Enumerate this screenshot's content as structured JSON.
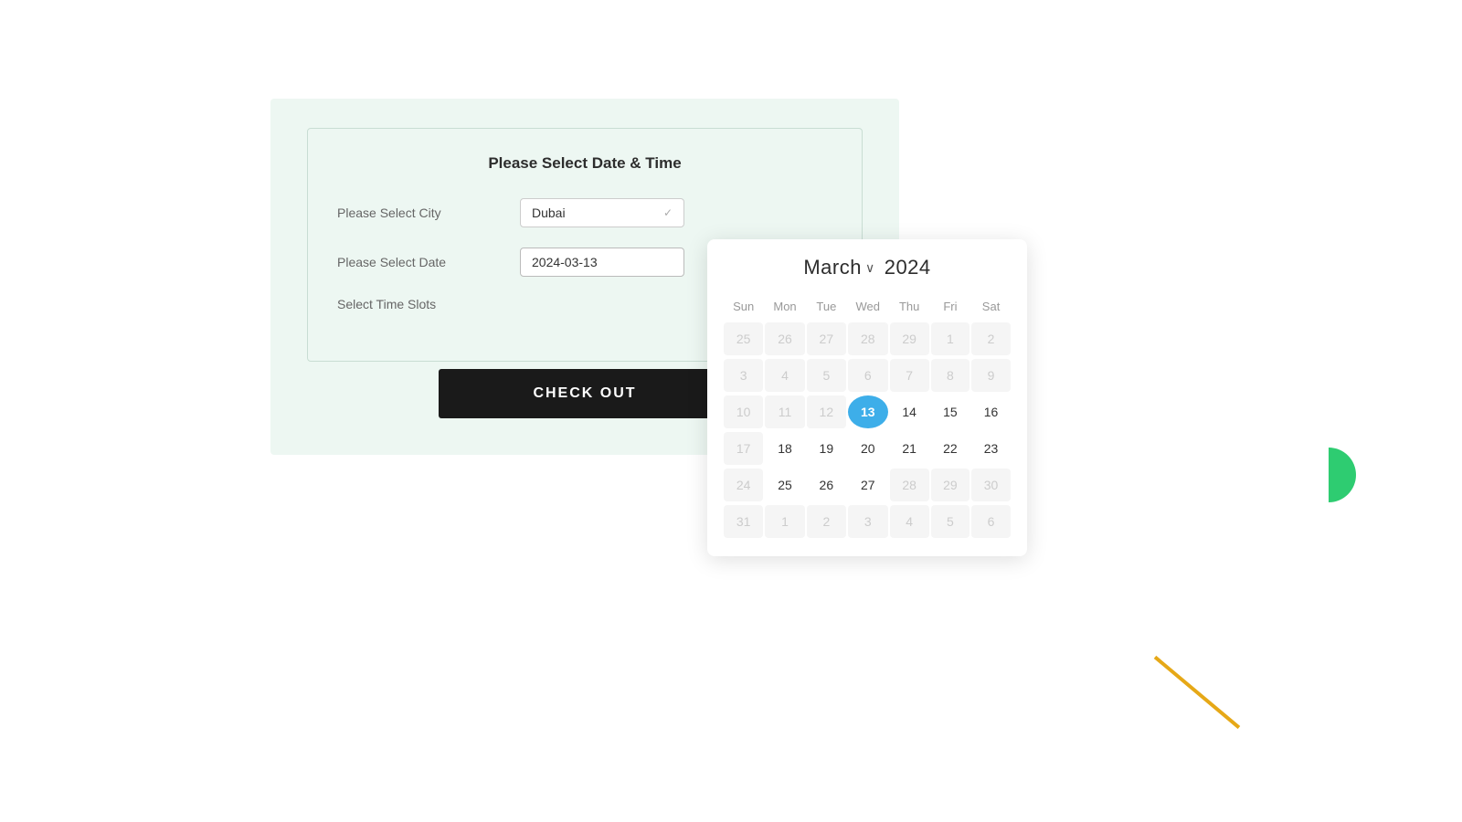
{
  "page": {
    "background": "#ffffff"
  },
  "card": {
    "title": "Please Select Date & Time",
    "city_label": "Please Select City",
    "date_label": "Please Select Date",
    "time_label": "Select Time Slots",
    "city_value": "Dubai",
    "date_value": "2024-03-13",
    "checkout_label": "CHECK OUT"
  },
  "calendar": {
    "month_label": "March",
    "month_arrow": "∨",
    "year_label": "2024",
    "headers": [
      "Sun",
      "Mon",
      "Tue",
      "Wed",
      "Thu",
      "Fri",
      "Sat"
    ],
    "weeks": [
      [
        {
          "day": "25",
          "type": "outside"
        },
        {
          "day": "26",
          "type": "outside"
        },
        {
          "day": "27",
          "type": "outside"
        },
        {
          "day": "28",
          "type": "outside"
        },
        {
          "day": "29",
          "type": "outside"
        },
        {
          "day": "1",
          "type": "outside"
        },
        {
          "day": "2",
          "type": "outside"
        }
      ],
      [
        {
          "day": "3",
          "type": "outside"
        },
        {
          "day": "4",
          "type": "outside"
        },
        {
          "day": "5",
          "type": "outside"
        },
        {
          "day": "6",
          "type": "outside"
        },
        {
          "day": "7",
          "type": "outside"
        },
        {
          "day": "8",
          "type": "outside"
        },
        {
          "day": "9",
          "type": "outside"
        }
      ],
      [
        {
          "day": "10",
          "type": "outside"
        },
        {
          "day": "11",
          "type": "outside"
        },
        {
          "day": "12",
          "type": "outside"
        },
        {
          "day": "13",
          "type": "selected"
        },
        {
          "day": "14",
          "type": "in-month"
        },
        {
          "day": "15",
          "type": "in-month"
        },
        {
          "day": "16",
          "type": "in-month"
        }
      ],
      [
        {
          "day": "17",
          "type": "outside"
        },
        {
          "day": "18",
          "type": "in-month"
        },
        {
          "day": "19",
          "type": "in-month"
        },
        {
          "day": "20",
          "type": "in-month"
        },
        {
          "day": "21",
          "type": "in-month"
        },
        {
          "day": "22",
          "type": "in-month"
        },
        {
          "day": "23",
          "type": "in-month"
        }
      ],
      [
        {
          "day": "24",
          "type": "outside"
        },
        {
          "day": "25",
          "type": "in-month"
        },
        {
          "day": "26",
          "type": "in-month"
        },
        {
          "day": "27",
          "type": "in-month"
        },
        {
          "day": "28",
          "type": "outside"
        },
        {
          "day": "29",
          "type": "outside"
        },
        {
          "day": "30",
          "type": "outside"
        }
      ],
      [
        {
          "day": "31",
          "type": "outside"
        },
        {
          "day": "1",
          "type": "outside"
        },
        {
          "day": "2",
          "type": "outside"
        },
        {
          "day": "3",
          "type": "outside"
        },
        {
          "day": "4",
          "type": "outside"
        },
        {
          "day": "5",
          "type": "outside"
        },
        {
          "day": "6",
          "type": "outside"
        }
      ]
    ]
  }
}
